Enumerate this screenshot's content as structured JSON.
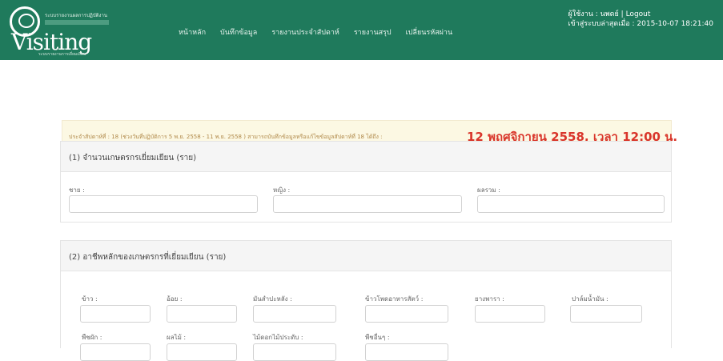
{
  "header": {
    "logo_small_text": "ระบบรายงานผลการปฏิบัติงาน",
    "logo_main_text": "Visiting",
    "logo_tag_text": "ระบบรายงานการเยี่ยมเยียน",
    "nav": [
      "หน้าหลัก",
      "บันทึกข้อมูล",
      "รายงานประจำสัปดาห์",
      "รายงานสรุป",
      "เปลี่ยนรหัสผ่าน"
    ],
    "user_line": "ผู้ใช้งาน : นพดย์ |",
    "logout_label": "Logout",
    "last_login_line": "เข้าสู่ระบบล่าสุดเมื่อ : 2015-10-07 18:21:40"
  },
  "notice": {
    "text": "ประจำสัปดาห์ที่ : 18 (ช่วงวันที่ปฏิบัติการ 5 พ.ย. 2558 - 11 พ.ย. 2558 ) สามารถบันทึกข้อมูลหรือแก้ไขข้อมูลสัปดาห์ที่ 18 ได้ถึง :",
    "deadline": "12 พฤศจิกายน 2558, เวลา 12:00 น."
  },
  "section1": {
    "title": "(1) จำนวนเกษตรกรเยี่ยมเยียน (ราย)",
    "fields": [
      "ชาย :",
      "หญิง :",
      "ผลรวม :"
    ],
    "values": [
      "",
      "",
      ""
    ]
  },
  "section2": {
    "title": "(2) อาชีพหลักของเกษตรกรที่เยี่ยมเยียน (ราย)",
    "fields_row1": [
      "ข้าว :",
      "อ้อย :",
      "มันสำปะหลัง :",
      "ข้าวโพดอาหารสัตว์ :",
      "ยางพารา :",
      "ปาล์มน้ำมัน :"
    ],
    "fields_row2": [
      "พืชผัก :",
      "ผลไม้ :",
      "ไม้ดอกไม้ประดับ :",
      "พืชอื่นๆ :"
    ],
    "values_row1": [
      "",
      "",
      "",
      "",
      "",
      ""
    ],
    "values_row2": [
      "",
      "",
      "",
      ""
    ]
  }
}
